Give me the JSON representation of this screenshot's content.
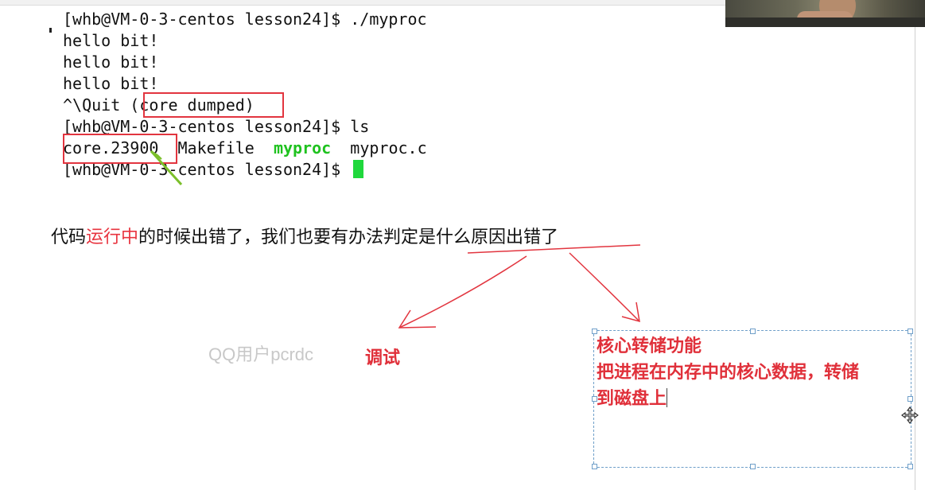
{
  "terminal": {
    "lines": {
      "l1": "[whb@VM-0-3-centos lesson24]$ ./myproc",
      "l2": "hello bit!",
      "l3": "hello bit!",
      "l4": "hello bit!",
      "l5_prefix": "^\\Quit ",
      "l5_boxed": "(core dumped)",
      "l6": "[whb@VM-0-3-centos lesson24]$ ls",
      "l7_core": "core.23900",
      "l7_makefile": "Makefile",
      "l7_myproc": "myproc",
      "l7_myproc_c": "myproc.c",
      "l8": "[whb@VM-0-3-centos lesson24]$ "
    }
  },
  "note": {
    "part1": "代码",
    "part2": "运行中",
    "part3": "的时候出错了，我们也要有办法判定是什么原因出错了"
  },
  "debug_label": "调试",
  "watermark": "QQ用户pcrdc",
  "textbox": {
    "line1": "核心转储功能",
    "line2": "把进程在内存中的核心数据，转储",
    "line3": "到磁盘上"
  },
  "colors": {
    "annotation_red": "#e2353f",
    "executable_green": "#1fc21f",
    "cursor_green": "#1fd83c",
    "pointer_arrow": "#7bbf2a"
  },
  "icons": {
    "move_cursor": "move-icon",
    "pointer": "pointer-arrow-icon"
  }
}
